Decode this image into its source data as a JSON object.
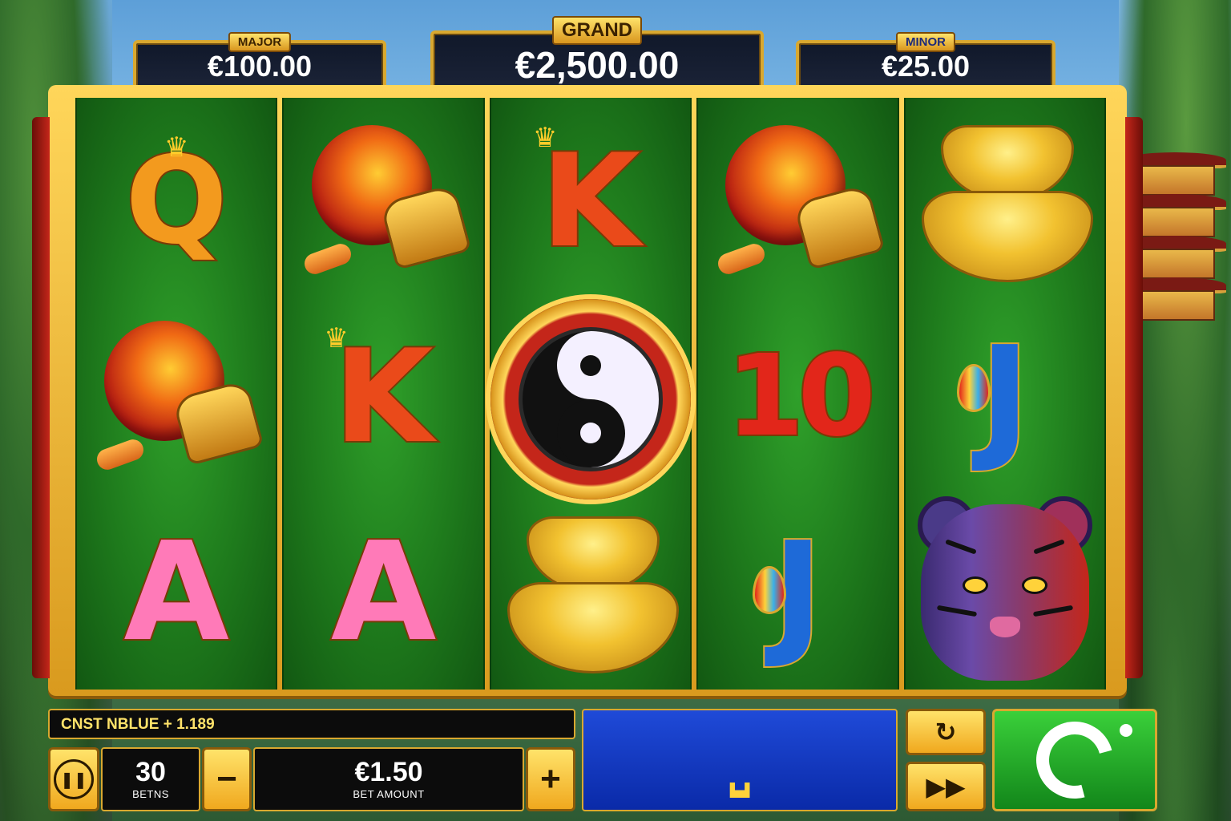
{
  "jackpots": {
    "major": {
      "label": "MAJOR",
      "value": "€100.00"
    },
    "grand": {
      "label": "GRAND",
      "value": "€2,500.00"
    },
    "minor": {
      "label": "MINOR",
      "value": "€25.00"
    }
  },
  "reels": [
    [
      "Q",
      "lantern",
      "A"
    ],
    [
      "lantern",
      "K",
      "A"
    ],
    [
      "K",
      "yin-yang-wild",
      "gold-ingot"
    ],
    [
      "lantern",
      "10",
      "J"
    ],
    [
      "gold-ingot",
      "J",
      "tiger"
    ]
  ],
  "symbols": {
    "Q": "Q",
    "K": "K",
    "A": "A",
    "ten": "10",
    "J": "J"
  },
  "status_message": "CNST NBLUE + 1.189",
  "controls": {
    "lines_value": "30",
    "lines_label": "BETNS",
    "bet_value": "€1.50",
    "bet_label": "BET AMOUNT",
    "minus": "−",
    "plus": "+",
    "menu_icon": "pause-icon",
    "autoplay_icon": "autoplay-icon",
    "fast_icon": "fast-forward-icon",
    "spin_icon": "spin-icon"
  },
  "colors": {
    "frame": "#d9a82f",
    "reel_bg": "#1e7a1c",
    "spin": "#12861a",
    "win_panel": "#1f4ad8"
  }
}
